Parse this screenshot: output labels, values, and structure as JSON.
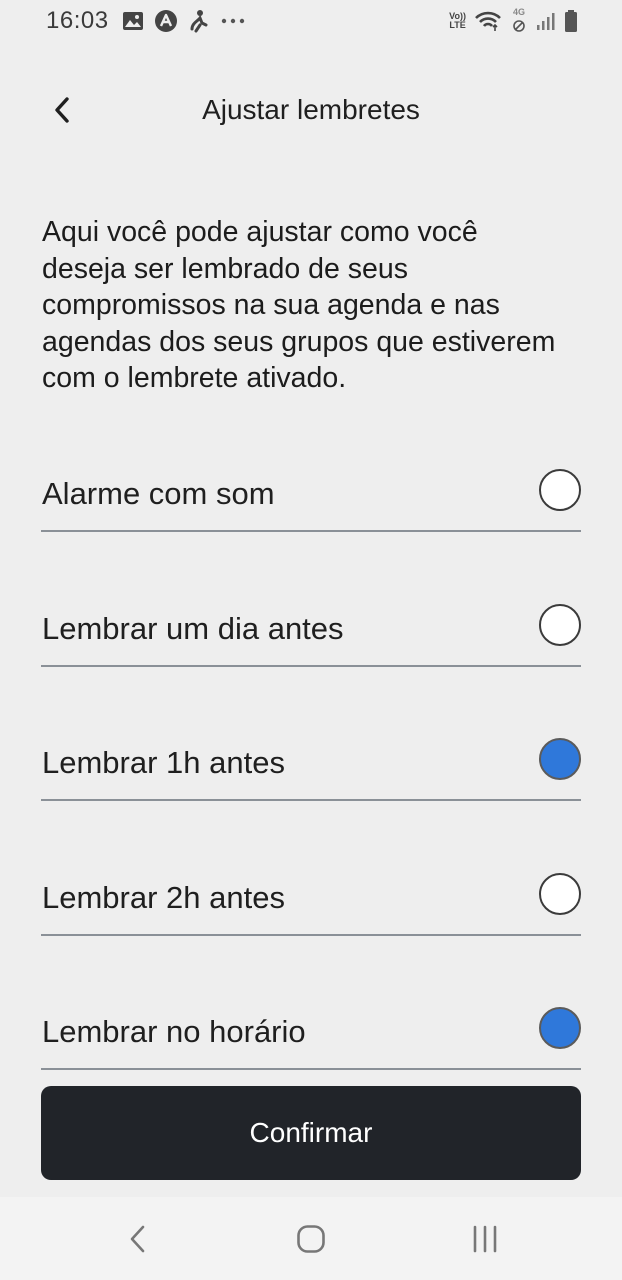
{
  "status_bar": {
    "time": "16:03",
    "left_icons": [
      "gallery-icon",
      "navigation-a-icon",
      "accessibility-icon",
      "more-dots-icon"
    ],
    "volte_top": "Vo))",
    "volte_bottom": "LTE",
    "network_label": "4G",
    "right_icons": [
      "volte-icon",
      "wifi-icon",
      "mobile-data-icon",
      "signal-icon",
      "battery-icon"
    ]
  },
  "header": {
    "back_icon": "chevron-left-icon",
    "title": "Ajustar lembretes"
  },
  "description": "Aqui você pode ajustar como você deseja ser lembrado de seus compromissos na sua agenda e nas agendas dos seus grupos que estiverem com o lembrete ativado.",
  "options": [
    {
      "label": "Alarme com som",
      "checked": false
    },
    {
      "label": "Lembrar um dia antes",
      "checked": false
    },
    {
      "label": "Lembrar 1h antes",
      "checked": true
    },
    {
      "label": "Lembrar 2h antes",
      "checked": false
    },
    {
      "label": "Lembrar no horário",
      "checked": true
    }
  ],
  "confirm_label": "Confirmar",
  "colors": {
    "accent": "#2f78da",
    "button_bg": "#212429",
    "background": "#eeeeee"
  },
  "nav_bar": {
    "icons": [
      "back-nav-icon",
      "home-nav-icon",
      "recents-nav-icon"
    ]
  }
}
